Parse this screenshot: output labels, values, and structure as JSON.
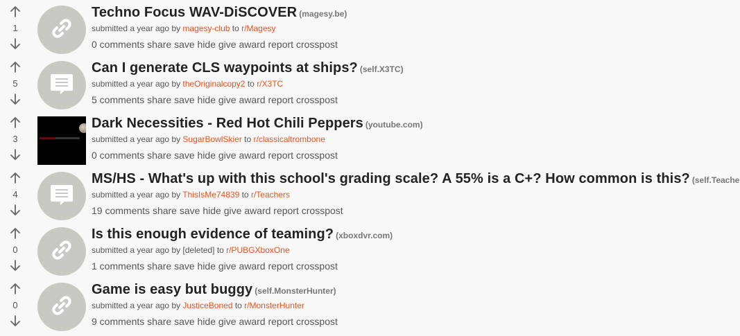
{
  "posts": [
    {
      "score": "1",
      "title": "Techno Focus WAV-DiSCOVER",
      "domain": "(magesy.be)",
      "thumb": "link-icon",
      "submitted": "submitted a year ago by",
      "author": "magesy-club",
      "to": "to",
      "subreddit": "r/Magesy",
      "actions": [
        "0 comments",
        "share",
        "save",
        "hide",
        "give award",
        "report",
        "crosspost"
      ]
    },
    {
      "score": "5",
      "title": "Can I generate CLS waypoints at ships?",
      "domain": "(self.X3TC)",
      "thumb": "text-post-icon",
      "submitted": "submitted a year ago by",
      "author": "theOriginalcopy2",
      "to": "to",
      "subreddit": "r/X3TC",
      "actions": [
        "5 comments",
        "share",
        "save",
        "hide",
        "give award",
        "report",
        "crosspost"
      ]
    },
    {
      "score": "3",
      "title": "Dark Necessities - Red Hot Chili Peppers",
      "domain": "(youtube.com)",
      "thumb": "video-thumbnail",
      "submitted": "submitted a year ago by",
      "author": "SugarBowlSkier",
      "to": "to",
      "subreddit": "r/classicaltrombone",
      "actions": [
        "0 comments",
        "share",
        "save",
        "hide",
        "give award",
        "report",
        "crosspost"
      ]
    },
    {
      "score": "4",
      "title": "MS/HS - What's up with this school's grading scale? A 55% is a C+? How common is this?",
      "domain": "(self.Teachers)",
      "thumb": "text-post-icon",
      "submitted": "submitted a year ago by",
      "author": "ThisIsMe74839",
      "to": "to",
      "subreddit": "r/Teachers",
      "actions": [
        "19 comments",
        "share",
        "save",
        "hide",
        "give award",
        "report",
        "crosspost"
      ]
    },
    {
      "score": "0",
      "title": "Is this enough evidence of teaming?",
      "domain": "(xboxdvr.com)",
      "thumb": "link-icon",
      "submitted": "submitted a year ago by",
      "author": "[deleted]",
      "author_plain": true,
      "to": "to",
      "subreddit": "r/PUBGXboxOne",
      "actions": [
        "1 comments",
        "share",
        "save",
        "hide",
        "give award",
        "report",
        "crosspost"
      ]
    },
    {
      "score": "0",
      "title": "Game is easy but buggy",
      "domain": "(self.MonsterHunter)",
      "thumb": "link-icon",
      "submitted": "submitted a year ago by",
      "author": "JusticeBoned",
      "to": "to",
      "subreddit": "r/MonsterHunter",
      "actions": [
        "9 comments",
        "share",
        "save",
        "hide",
        "give award",
        "report",
        "crosspost"
      ]
    }
  ],
  "colors": {
    "accent": "#e5531a",
    "thumb_bg": "#c9c9c4",
    "background": "#f8f8f8"
  }
}
